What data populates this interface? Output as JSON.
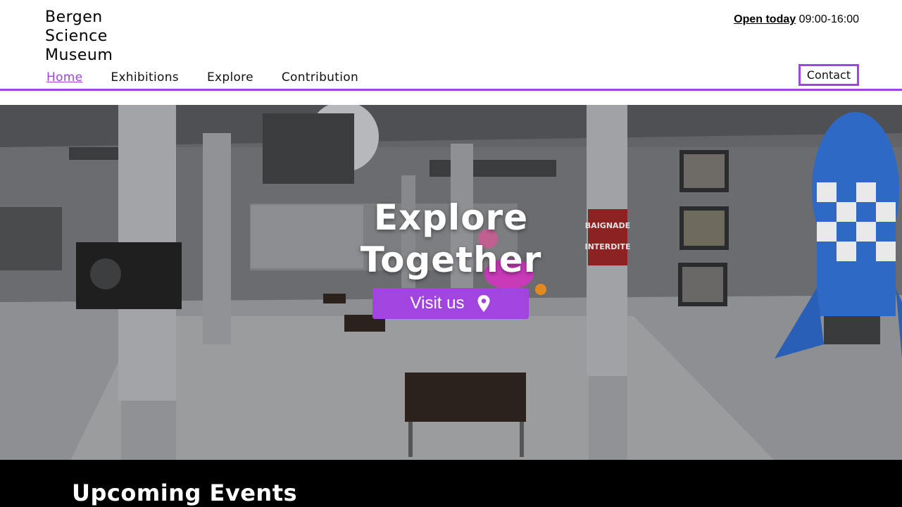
{
  "header": {
    "logo_lines": [
      "Bergen",
      "Science",
      "Museum"
    ],
    "hours_label": "Open today",
    "hours_value": "09:00-16:00",
    "contact_label": "Contact"
  },
  "nav": {
    "items": [
      {
        "label": "Home",
        "active": true
      },
      {
        "label": "Exhibitions",
        "active": false
      },
      {
        "label": "Explore",
        "active": false
      },
      {
        "label": "Contribution",
        "active": false
      }
    ]
  },
  "hero": {
    "title_line1": "Explore",
    "title_line2": "Together",
    "button_label": "Visit us",
    "button_icon": "map-pin-icon",
    "scene_signs": [
      "BAIGNADE",
      "INTERDITE"
    ]
  },
  "events": {
    "heading": "Upcoming Events"
  },
  "colors": {
    "accent": "#a244e0",
    "footer_bg": "#000000",
    "text": "#111111"
  }
}
